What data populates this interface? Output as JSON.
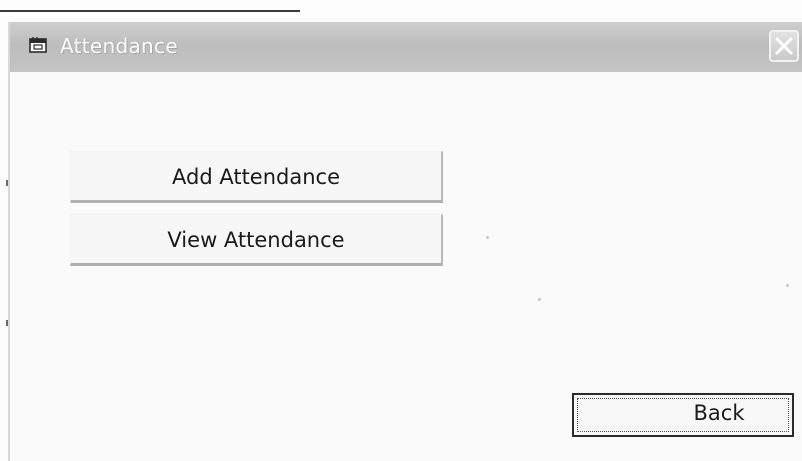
{
  "window": {
    "title": "Attendance",
    "title_icon": "window-icon",
    "close_icon": "close-icon"
  },
  "buttons": {
    "add_attendance": "Add Attendance",
    "view_attendance": "View Attendance",
    "back": "Back"
  }
}
